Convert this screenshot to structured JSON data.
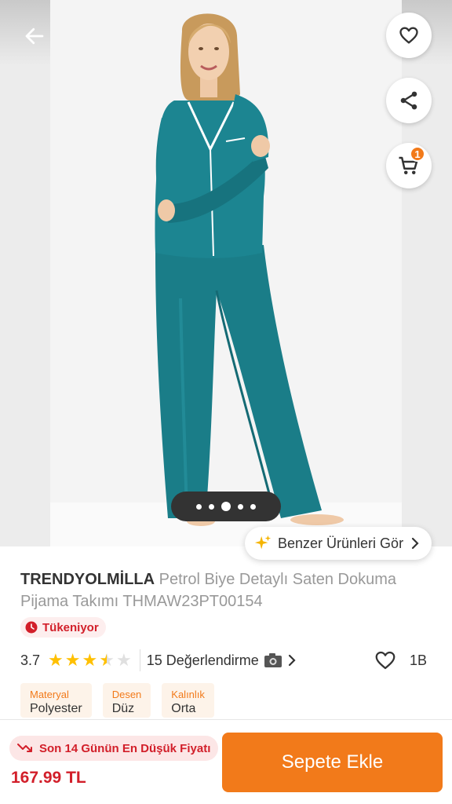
{
  "product": {
    "brand": "TRENDYOLMİLLA",
    "name": "Petrol Biye Detaylı Saten Dokuma Pijama Takımı THMAW23PT00154",
    "stock_status": "Tükeniyor"
  },
  "gallery": {
    "page_count": 5,
    "active_index": 2,
    "similar_products_label": "Benzer Ürünleri Gör"
  },
  "header": {
    "cart_count": "1"
  },
  "rating": {
    "value": "3.7",
    "stars": 3.5,
    "reviews_label": "15 Değerlendirme",
    "favorites_count": "1B"
  },
  "attributes": [
    {
      "name": "Materyal",
      "value": "Polyester"
    },
    {
      "name": "Desen",
      "value": "Düz"
    },
    {
      "name": "Kalınlık",
      "value": "Orta"
    }
  ],
  "bottom_bar": {
    "lowest_price_label": "Son 14 Günün En Düşük Fiyatı",
    "price": "167.99 TL",
    "add_to_cart_label": "Sepete Ekle"
  },
  "colors": {
    "accent": "#f27a1a",
    "danger": "#d21f2a",
    "star": "#ffc000",
    "garment": "#1a7d88"
  },
  "icons": {
    "back": "arrow-left-icon",
    "favorite": "heart-outline-icon",
    "share": "share-icon",
    "cart": "cart-icon",
    "sparkle": "sparkle-icon",
    "clock": "clock-icon",
    "camera": "camera-icon",
    "trend_down": "trend-down-icon"
  }
}
